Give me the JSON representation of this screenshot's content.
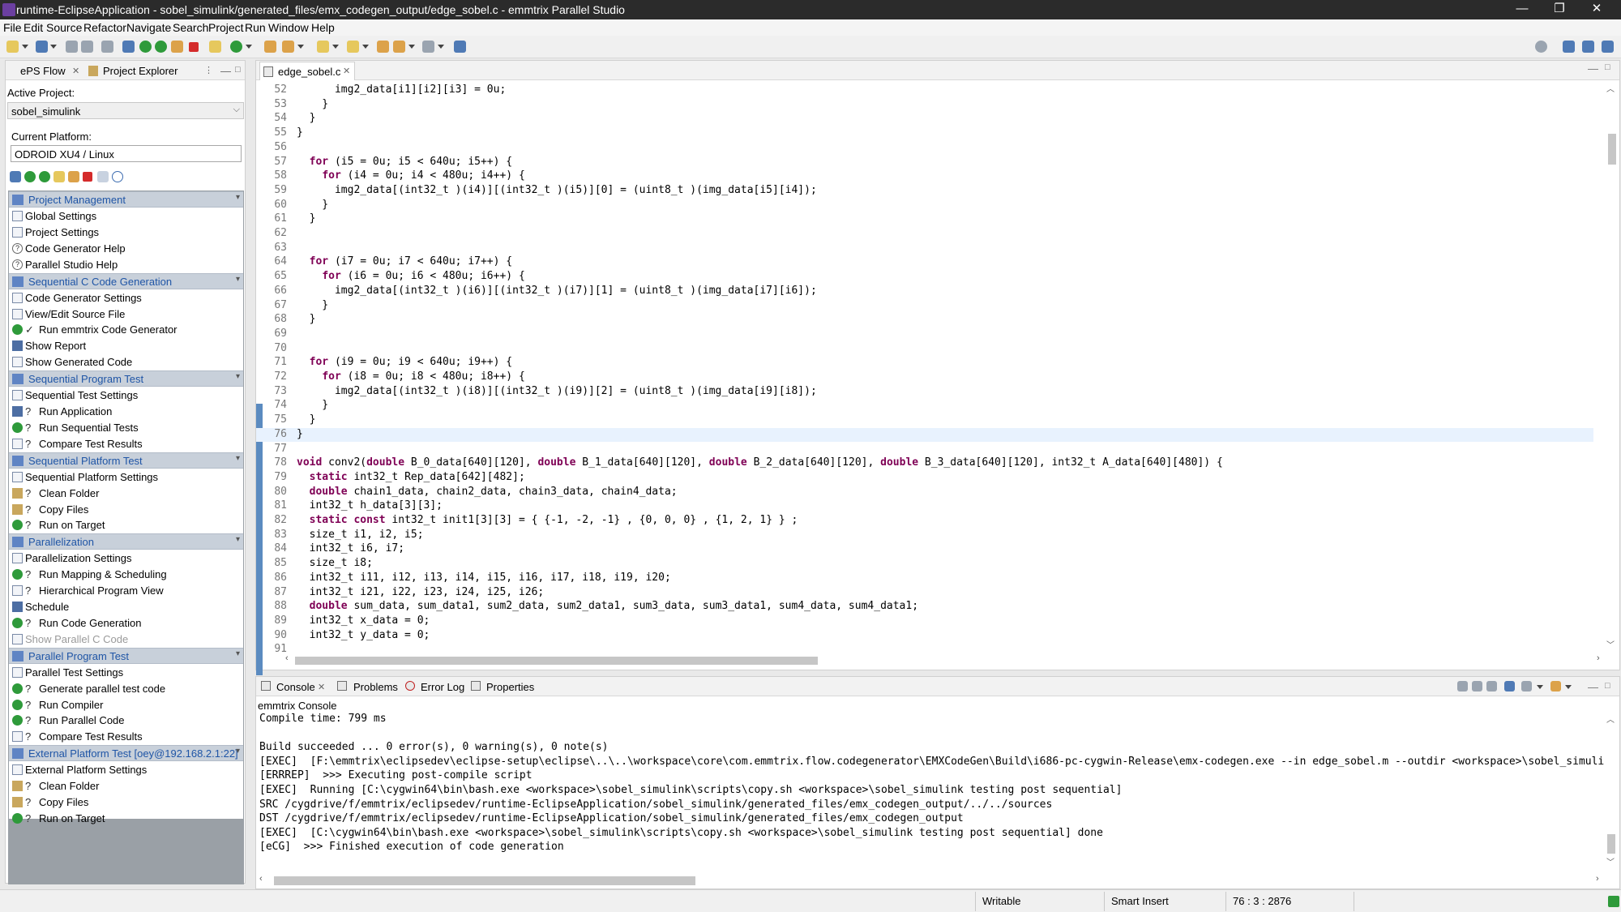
{
  "window": {
    "title": "runtime-EclipseApplication - sobel_simulink/generated_files/emx_codegen_output/edge_sobel.c - emmtrix Parallel Studio",
    "controls": [
      "—",
      "❐",
      "✕"
    ]
  },
  "menu": [
    "File",
    "Edit",
    "Source",
    "Refactor",
    "Navigate",
    "Search",
    "Project",
    "Run",
    "Window",
    "Help"
  ],
  "left_panel": {
    "tabs": [
      "ePS Flow",
      "Project Explorer"
    ],
    "active_project_label": "Active Project:",
    "active_project": "sobel_simulink",
    "current_platform_label": "Current Platform:",
    "current_platform": "ODROID XU4 / Linux",
    "sections": [
      {
        "title": "Project Management",
        "items": [
          {
            "label": "Global Settings",
            "icon": "doc"
          },
          {
            "label": "Project Settings",
            "icon": "doc"
          },
          {
            "label": "Code Generator Help",
            "icon": "q"
          },
          {
            "label": "Parallel Studio Help",
            "icon": "q"
          }
        ]
      },
      {
        "title": "Sequential C Code Generation",
        "items": [
          {
            "label": "Code Generator Settings",
            "icon": "doc"
          },
          {
            "label": "View/Edit Source File",
            "icon": "doc"
          },
          {
            "label": "Run emmtrix Code Generator",
            "icon": "play",
            "state": "✓"
          },
          {
            "label": "Show Report",
            "icon": "sc"
          },
          {
            "label": "Show Generated Code",
            "icon": "doc"
          }
        ]
      },
      {
        "title": "Sequential Program Test",
        "items": [
          {
            "label": "Sequential Test Settings",
            "icon": "doc"
          },
          {
            "label": "Run Application",
            "icon": "sc",
            "state": "?"
          },
          {
            "label": "Run Sequential Tests",
            "icon": "play",
            "state": "?"
          },
          {
            "label": "Compare Test Results",
            "icon": "doc",
            "state": "?"
          }
        ]
      },
      {
        "title": "Sequential Platform Test",
        "items": [
          {
            "label": "Sequential Platform Settings",
            "icon": "doc"
          },
          {
            "label": "Clean Folder",
            "icon": "bn",
            "state": "?"
          },
          {
            "label": "Copy Files",
            "icon": "bn",
            "state": "?"
          },
          {
            "label": "Run on Target",
            "icon": "play",
            "state": "?"
          }
        ]
      },
      {
        "title": "Parallelization",
        "items": [
          {
            "label": "Parallelization Settings",
            "icon": "doc"
          },
          {
            "label": "Run Mapping & Scheduling",
            "icon": "play",
            "state": "?"
          },
          {
            "label": "Hierarchical Program View",
            "icon": "doc",
            "state": "?"
          },
          {
            "label": "Schedule",
            "icon": "sc"
          },
          {
            "label": "Run Code Generation",
            "icon": "play",
            "state": "?"
          },
          {
            "label": "Show Parallel C Code",
            "icon": "doc",
            "disabled": true
          }
        ]
      },
      {
        "title": "Parallel Program Test",
        "items": [
          {
            "label": "Parallel Test Settings",
            "icon": "doc"
          },
          {
            "label": "Generate parallel test code",
            "icon": "play",
            "state": "?"
          },
          {
            "label": "Run Compiler",
            "icon": "play",
            "state": "?"
          },
          {
            "label": "Run Parallel Code",
            "icon": "play",
            "state": "?"
          },
          {
            "label": "Compare Test Results",
            "icon": "doc",
            "state": "?"
          }
        ]
      },
      {
        "title": "External Platform Test [oey@192.168.2.1:22]",
        "items": [
          {
            "label": "External Platform Settings",
            "icon": "doc"
          },
          {
            "label": "Clean Folder",
            "icon": "bn",
            "state": "?"
          },
          {
            "label": "Copy Files",
            "icon": "bn",
            "state": "?"
          },
          {
            "label": "Run on Target",
            "icon": "play",
            "state": "?"
          }
        ]
      }
    ]
  },
  "editor": {
    "tab": "edge_sobel.c",
    "current_line": 76,
    "lines": [
      {
        "n": "52",
        "code": "      img2_data[i1][i2][i3] = 0u;"
      },
      {
        "n": "53",
        "code": "    }"
      },
      {
        "n": "54",
        "code": "  }"
      },
      {
        "n": "55",
        "code": "}"
      },
      {
        "n": "56",
        "code": ""
      },
      {
        "n": "57",
        "code": "  for (i5 = 0u; i5 < 640u; i5++) {"
      },
      {
        "n": "58",
        "code": "    for (i4 = 0u; i4 < 480u; i4++) {"
      },
      {
        "n": "59",
        "code": "      img2_data[(int32_t )(i4)][(int32_t )(i5)][0] = (uint8_t )(img_data[i5][i4]);"
      },
      {
        "n": "60",
        "code": "    }"
      },
      {
        "n": "61",
        "code": "  }"
      },
      {
        "n": "62",
        "code": ""
      },
      {
        "n": "63",
        "code": ""
      },
      {
        "n": "64",
        "code": "  for (i7 = 0u; i7 < 640u; i7++) {"
      },
      {
        "n": "65",
        "code": "    for (i6 = 0u; i6 < 480u; i6++) {"
      },
      {
        "n": "66",
        "code": "      img2_data[(int32_t )(i6)][(int32_t )(i7)][1] = (uint8_t )(img_data[i7][i6]);"
      },
      {
        "n": "67",
        "code": "    }"
      },
      {
        "n": "68",
        "code": "  }"
      },
      {
        "n": "69",
        "code": ""
      },
      {
        "n": "70",
        "code": ""
      },
      {
        "n": "71",
        "code": "  for (i9 = 0u; i9 < 640u; i9++) {"
      },
      {
        "n": "72",
        "code": "    for (i8 = 0u; i8 < 480u; i8++) {"
      },
      {
        "n": "73",
        "code": "      img2_data[(int32_t )(i8)][(int32_t )(i9)][2] = (uint8_t )(img_data[i9][i8]);"
      },
      {
        "n": "74",
        "code": "    }"
      },
      {
        "n": "75",
        "code": "  }"
      },
      {
        "n": "76",
        "code": "}"
      },
      {
        "n": "77",
        "code": ""
      },
      {
        "n": "78",
        "code": "void conv2(double B_0_data[640][120], double B_1_data[640][120], double B_2_data[640][120], double B_3_data[640][120], int32_t A_data[640][480]) {"
      },
      {
        "n": "79",
        "code": "  static int32_t Rep_data[642][482];"
      },
      {
        "n": "80",
        "code": "  double chain1_data, chain2_data, chain3_data, chain4_data;"
      },
      {
        "n": "81",
        "code": "  int32_t h_data[3][3];"
      },
      {
        "n": "82",
        "code": "  static const int32_t init1[3][3] = { {-1, -2, -1} , {0, 0, 0} , {1, 2, 1} } ;"
      },
      {
        "n": "83",
        "code": "  size_t i1, i2, i5;"
      },
      {
        "n": "84",
        "code": "  int32_t i6, i7;"
      },
      {
        "n": "85",
        "code": "  size_t i8;"
      },
      {
        "n": "86",
        "code": "  int32_t i11, i12, i13, i14, i15, i16, i17, i18, i19, i20;"
      },
      {
        "n": "87",
        "code": "  int32_t i21, i22, i23, i24, i25, i26;"
      },
      {
        "n": "88",
        "code": "  double sum_data, sum_data1, sum2_data, sum2_data1, sum3_data, sum3_data1, sum4_data, sum4_data1;"
      },
      {
        "n": "89",
        "code": "  int32_t x_data = 0;"
      },
      {
        "n": "90",
        "code": "  int32_t y_data = 0;"
      },
      {
        "n": "91",
        "code": ""
      }
    ]
  },
  "console": {
    "tabs": [
      "Console",
      "Problems",
      "Error Log",
      "Properties"
    ],
    "title": "emmtrix Console",
    "lines": [
      "Compile time: 799 ms",
      "",
      "Build succeeded ... 0 error(s), 0 warning(s), 0 note(s)",
      "[EXEC]  [F:\\emmtrix\\eclipsedev\\eclipse-setup\\eclipse\\..\\..\\workspace\\core\\com.emmtrix.flow.codegenerator\\EMXCodeGen\\Build\\i686-pc-cygwin-Release\\emx-codegen.exe --in edge_sobel.m --outdir <workspace>\\sobel_simulin",
      "[ERRREP]  >>> Executing post-compile script",
      "[EXEC]  Running [C:\\cygwin64\\bin\\bash.exe <workspace>\\sobel_simulink\\scripts\\copy.sh <workspace>\\sobel_simulink testing post sequential]",
      "SRC /cygdrive/f/emmtrix/eclipsedev/runtime-EclipseApplication/sobel_simulink/generated_files/emx_codegen_output/../../sources",
      "DST /cygdrive/f/emmtrix/eclipsedev/runtime-EclipseApplication/sobel_simulink/generated_files/emx_codegen_output",
      "[EXEC]  [C:\\cygwin64\\bin\\bash.exe <workspace>\\sobel_simulink\\scripts\\copy.sh <workspace>\\sobel_simulink testing post sequential] done",
      "[eCG]  >>> Finished execution of code generation"
    ]
  },
  "status": {
    "mode": "Writable",
    "insert": "Smart Insert",
    "position": "76 : 3 : 2876"
  },
  "keywords": [
    "for",
    "void",
    "double",
    "static",
    "const"
  ]
}
